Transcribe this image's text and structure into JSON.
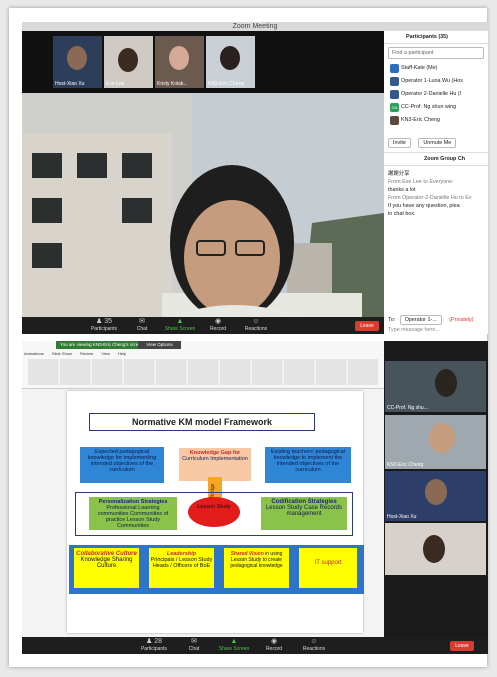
{
  "window_title": "Zoom Meeting",
  "gallery": [
    {
      "name": "Host-Xiao Xu"
    },
    {
      "name": "Eve Lee"
    },
    {
      "name": "Kristy Kotsk..."
    },
    {
      "name": "KN3-Eric Cheng"
    }
  ],
  "toolbar": {
    "participants_label": "Participants",
    "participants_count": "35",
    "chat_label": "Chat",
    "share_label": "Share Screen",
    "record_label": "Record",
    "reactions_label": "Reactions",
    "leave_label": "Leave"
  },
  "panel": {
    "title": "Participants (35)",
    "search_placeholder": "Find a participant",
    "participants": [
      {
        "initials": "SK",
        "name": "Staff-Kate (Me)"
      },
      {
        "initials": "OP",
        "name": "Operator 1-Luna Wu (Hos"
      },
      {
        "initials": "OP",
        "name": "Operator 2-Danielle Hu (I"
      },
      {
        "initials": "CN",
        "name": "CC-Prof. Ng shun wing"
      },
      {
        "initials": "KE",
        "name": "KN3-Eric Cheng"
      }
    ],
    "invite_label": "Invite",
    "unmute_label": "Unmute Me",
    "chat_title": "Zoom Group Ch",
    "chat_lines": [
      {
        "from": "",
        "text": "謝謝分享"
      },
      {
        "from": "From Eve Lee to Everyone:",
        "text": "thanks a lot"
      },
      {
        "from": "From Operator-2-Danielle Hu to Ev",
        "text": "If you have any question, plea"
      },
      {
        "from": "",
        "text": "in chat box."
      }
    ],
    "to_label": "To:",
    "to_value": "Operator 1-...",
    "to_private": "(Privately)",
    "message_placeholder": "Type message here..."
  },
  "screen2": {
    "viewing_banner": "You are viewing KN3-Eric Cheng's screen",
    "view_options": "View Options",
    "menu": [
      "Animations",
      "Slide Show",
      "Review",
      "View",
      "Help"
    ],
    "slide": {
      "title": "Normative KM model Framework",
      "box_left": "Expected pedagogical knowledge  for implementing intended objectives of the curriculum",
      "box_gap_title": "Knowledge Gap for",
      "box_gap_text": "Curriculum Implementation",
      "box_right": "Existing teachers' pedagogical knowledge to implement the intended objectives of the curriculum",
      "bridge_label": "Bridge",
      "person_title": "Personalization Strategies",
      "person_text": "Professional Learning communities Communities of practice Lesson Study Communities",
      "lesson_study": "Lesson Study",
      "codif_title": "Codification Strategies",
      "codif_text": "Lesson Study Case Records management",
      "collab_title": "Collaborative Culture",
      "collab_text": "Knowledge Sharing Culture",
      "lead_title": "Leadership",
      "lead_text": "Principals / Lesson Study Heads / Officers of BoE",
      "shared_title": "Shared Vision",
      "shared_text": "in using Lesson Study to create pedagogical knowledge",
      "it_support": "IT support"
    },
    "thumbs": [
      {
        "name": "CC-Prof. Ng shu..."
      },
      {
        "name": "KN3-Eric Cheng"
      },
      {
        "name": "Host-Xiao Xu"
      },
      {
        "name": ""
      }
    ],
    "toolbar": {
      "participants_label": "Participants",
      "participants_count": "28",
      "chat_label": "Chat",
      "share_label": "Share Screen",
      "record_label": "Record",
      "reactions_label": "Reactions",
      "leave_label": "Leave"
    }
  }
}
